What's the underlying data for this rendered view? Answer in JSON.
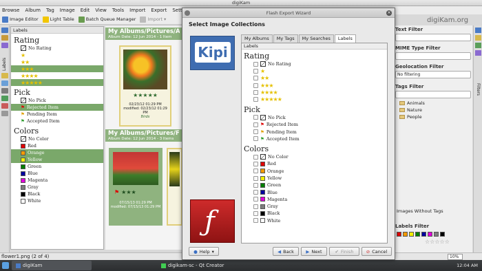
{
  "window": {
    "title": "digiKam"
  },
  "menubar": {
    "items": [
      "Browse",
      "Album",
      "Tag",
      "Image",
      "Edit",
      "View",
      "Tools",
      "Import",
      "Export",
      "Settings"
    ]
  },
  "toolbar": {
    "image_editor": "Image Editor",
    "light_table": "Light Table",
    "batch_queue": "Batch Queue Manager",
    "import": "Import"
  },
  "left_sidebar": {
    "tab_label": "Labels"
  },
  "labels_panel": {
    "header": "Labels",
    "rating_title": "Rating",
    "rating_rows": [
      {
        "label": "No Rating"
      },
      {
        "stars": 1
      },
      {
        "stars": 2
      },
      {
        "stars": 3
      },
      {
        "stars": 4
      },
      {
        "stars": 5
      }
    ],
    "pick_title": "Pick",
    "pick_rows": [
      "No Pick",
      "Rejected Item",
      "Pending Item",
      "Accepted Item"
    ],
    "colors_title": "Colors",
    "color_rows": [
      {
        "label": "No Color",
        "color": ""
      },
      {
        "label": "Red",
        "color": "#e00000"
      },
      {
        "label": "Orange",
        "color": "#f39a00"
      },
      {
        "label": "Yellow",
        "color": "#f2ee00"
      },
      {
        "label": "Green",
        "color": "#007e00"
      },
      {
        "label": "Blue",
        "color": "#00009f"
      },
      {
        "label": "Magenta",
        "color": "#e000d9"
      },
      {
        "label": "Gray",
        "color": "#7d7d7d"
      },
      {
        "label": "Black",
        "color": "#000000"
      },
      {
        "label": "White",
        "color": "#ffffff"
      }
    ]
  },
  "albums": [
    {
      "title": "My Albums/Pictures/Animals",
      "subtitle": "Album Date: 12 Jun 2014 - 1 Item",
      "thumb_info": {
        "date": "02/23/12 01:29 PM",
        "modified": "modified: 02/23/12 01:29 PM",
        "tag": "Birds"
      }
    },
    {
      "title": "My Albums/Pictures/Flowers",
      "subtitle": "Album Date: 12 Jun 2014 - 3 Items",
      "thumb_info": {
        "date": "07/15/13 01:29 PM",
        "modified": "modified: 07/15/13 01:29 PM"
      }
    }
  ],
  "right_panel": {
    "text_filter_label": "Text Filter",
    "mime_label": "MIME Type Filter",
    "geo_label": "Geolocation Filter",
    "geo_value": "No filtering",
    "tags_label": "Tags Filter",
    "tags": [
      "Animals",
      "Nature",
      "People"
    ],
    "without_tags": "Images Without Tags",
    "labels_filter": "Labels Filter",
    "brand": "digiKam.org",
    "side_tab": "Filters"
  },
  "dialog": {
    "title": "Flash Export Wizard",
    "header": "Select Image Collections",
    "tabs": [
      "My Albums",
      "My Tags",
      "My Searches",
      "Labels"
    ],
    "list_header": "Labels",
    "rating_title": "Rating",
    "pick_title": "Pick",
    "colors_title": "Colors",
    "kipi_text": "Kipi",
    "buttons": {
      "help": "Help",
      "back": "Back",
      "next": "Next",
      "finish": "Finish",
      "cancel": "Cancel"
    }
  },
  "statusbar": {
    "text": "flower1.png (2 of 4)",
    "zoom": "10%"
  },
  "taskbar": {
    "tasks": [
      "digiKam",
      "digikam-sc - Qt Creator"
    ],
    "clock": "12:04 AM"
  }
}
